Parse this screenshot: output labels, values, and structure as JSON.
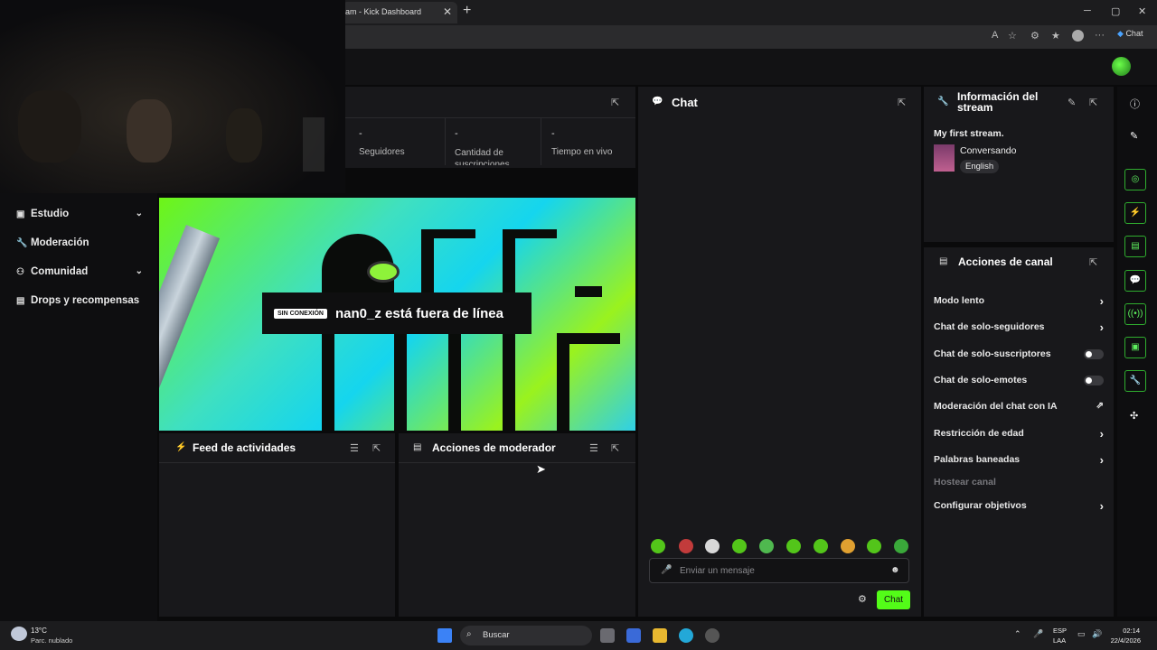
{
  "browser": {
    "tab_title": "am - Kick Dashboard",
    "copilot_label": "Chat",
    "minimize": "─",
    "maximize": "▢",
    "close": "✕"
  },
  "stats": [
    {
      "value": "-",
      "label": "Seguidores"
    },
    {
      "value": "-",
      "label": "Cantidad de suscripciones"
    },
    {
      "value": "-",
      "label": "Tiempo en vivo"
    }
  ],
  "sidebar": {
    "items": [
      {
        "label": "Estudio",
        "icon": "studio-icon"
      },
      {
        "label": "Moderación",
        "icon": "wrench-icon"
      },
      {
        "label": "Comunidad",
        "icon": "people-icon"
      },
      {
        "label": "Drops y recompensas",
        "icon": "chart-icon"
      }
    ]
  },
  "offline": {
    "badge": "SIN CONEXIÓN",
    "message": "nan0_z está fuera de línea",
    "art_text_1": "OFF-",
    "art_text_2": "LINE"
  },
  "panels": {
    "feed_title": "Feed de actividades",
    "mod_actions_title": "Acciones de moderador",
    "chat_title": "Chat",
    "stream_info_title": "Información del stream",
    "channel_actions_title": "Acciones de canal"
  },
  "stream_info": {
    "stream_title": "My first stream.",
    "category": "Conversando",
    "language": "English"
  },
  "channel_actions": {
    "slow_mode": "Modo lento",
    "followers_only": "Chat de solo-seguidores",
    "subs_only": "Chat de solo-suscriptores",
    "emotes_only": "Chat de solo-emotes",
    "ai_moderation": "Moderación del chat con IA",
    "age_restriction": "Restricción de edad",
    "banned_words": "Palabras baneadas",
    "host_channel": "Hostear canal",
    "goals": "Configurar objetivos"
  },
  "chat": {
    "placeholder": "Enviar un mensaje",
    "send_label": "Chat"
  },
  "taskbar": {
    "weather_temp": "13°C",
    "weather_desc": "Parc. nublado",
    "search_label": "Buscar",
    "lang_1": "ESP",
    "lang_2": "LAA",
    "time": "02:14",
    "date": "22/4/2026"
  },
  "colors": {
    "accent": "#53fc18",
    "panel_bg": "#18181b"
  }
}
